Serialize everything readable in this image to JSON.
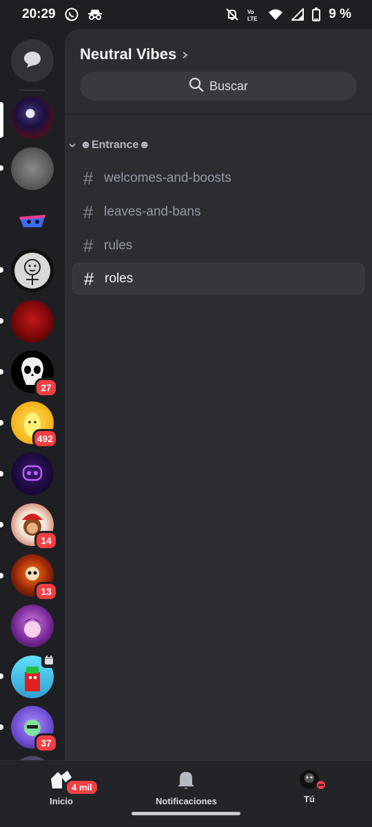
{
  "status_bar": {
    "time": "20:29",
    "battery": "9 %",
    "icons": [
      "whatsapp-icon",
      "incognito-icon",
      "mute-icon",
      "volte-icon",
      "wifi-icon",
      "signal-icon",
      "battery-icon"
    ]
  },
  "server": {
    "name": "Neutral Vibes",
    "search_label": "Buscar"
  },
  "category": {
    "label": "☻Entrance☻"
  },
  "channels": [
    {
      "name": "welcomes-and-boosts",
      "active": false
    },
    {
      "name": "leaves-and-bans",
      "active": false
    },
    {
      "name": "rules",
      "active": false
    },
    {
      "name": "roles",
      "active": true
    }
  ],
  "guilds": [
    {
      "badge": ""
    },
    {
      "badge": ""
    },
    {
      "badge": ""
    },
    {
      "badge": ""
    },
    {
      "badge": ""
    },
    {
      "badge": "27"
    },
    {
      "badge": "492"
    },
    {
      "badge": ""
    },
    {
      "badge": "14"
    },
    {
      "badge": "13"
    },
    {
      "badge": ""
    },
    {
      "badge": ""
    },
    {
      "badge": "37"
    }
  ],
  "bottom_nav": {
    "home_label": "Inicio",
    "home_badge": "4 mil",
    "notifications_label": "Notificaciones",
    "you_label": "Tú"
  },
  "colors": {
    "background": "#1e1f22",
    "panel": "#2b2d31",
    "badge_red": "#f23f43",
    "accent_text": "#f2f3f5"
  }
}
